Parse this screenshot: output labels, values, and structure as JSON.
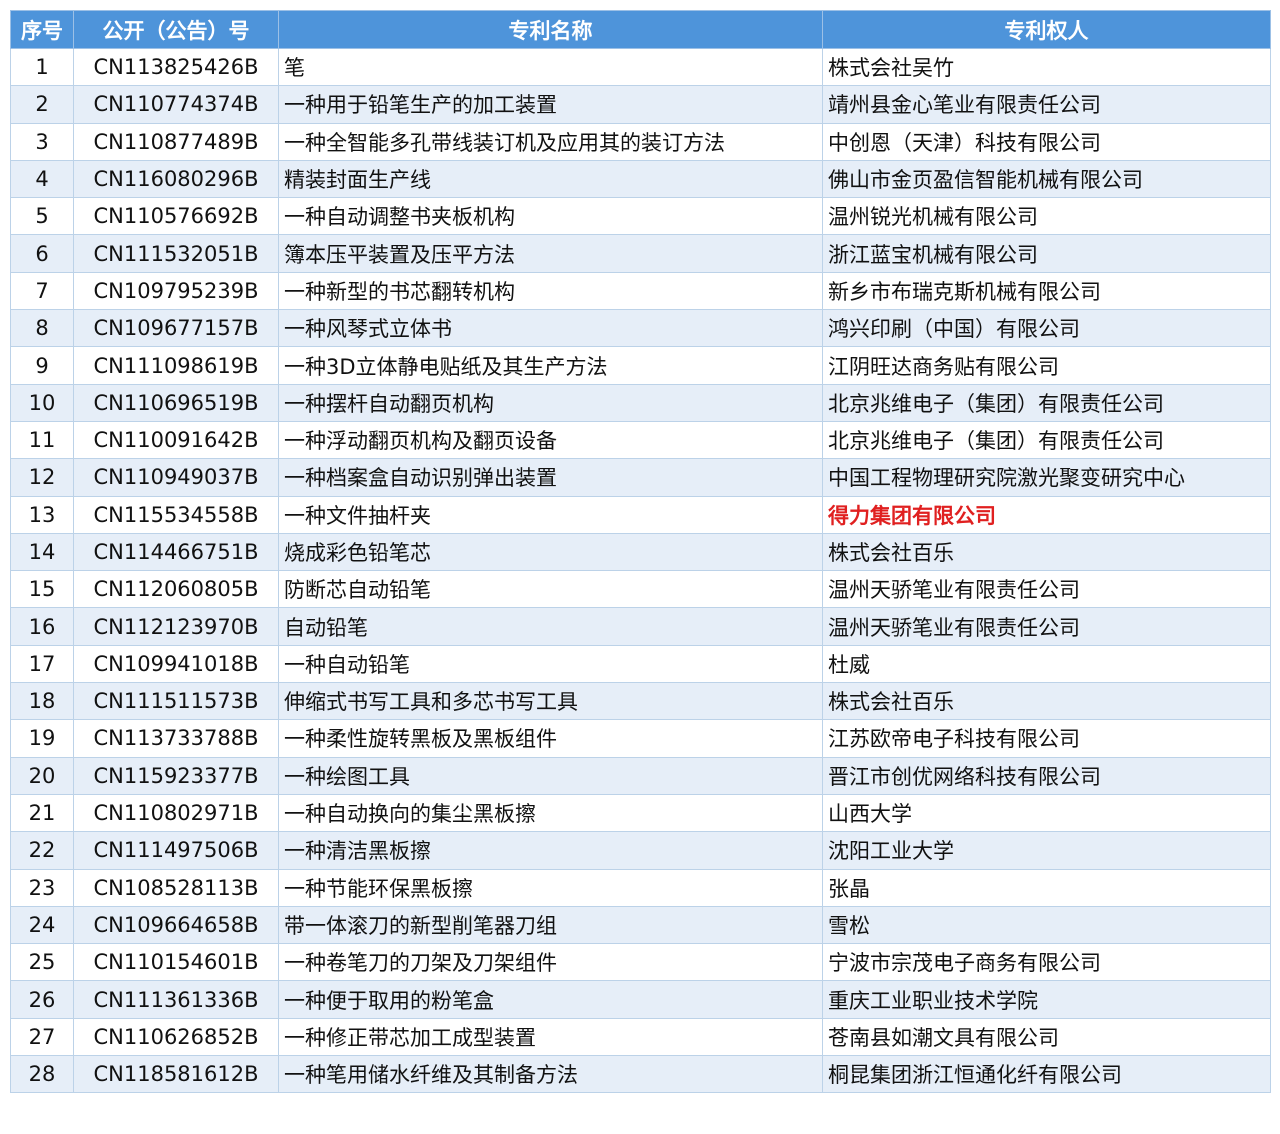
{
  "table": {
    "headers": [
      "序号",
      "公开（公告）号",
      "专利名称",
      "专利权人"
    ],
    "highlight_color": "#e02020",
    "header_color": "#4e94da",
    "rows": [
      {
        "no": "1",
        "code": "CN113825426B",
        "name": "笔",
        "owner": "株式会社吴竹"
      },
      {
        "no": "2",
        "code": "CN110774374B",
        "name": "一种用于铅笔生产的加工装置",
        "owner": "靖州县金心笔业有限责任公司"
      },
      {
        "no": "3",
        "code": "CN110877489B",
        "name": "一种全智能多孔带线装订机及应用其的装订方法",
        "owner": "中创恩（天津）科技有限公司"
      },
      {
        "no": "4",
        "code": "CN116080296B",
        "name": "精装封面生产线",
        "owner": "佛山市金页盈信智能机械有限公司"
      },
      {
        "no": "5",
        "code": "CN110576692B",
        "name": "一种自动调整书夹板机构",
        "owner": "温州锐光机械有限公司"
      },
      {
        "no": "6",
        "code": "CN111532051B",
        "name": "簿本压平装置及压平方法",
        "owner": "浙江蓝宝机械有限公司"
      },
      {
        "no": "7",
        "code": "CN109795239B",
        "name": "一种新型的书芯翻转机构",
        "owner": "新乡市布瑞克斯机械有限公司"
      },
      {
        "no": "8",
        "code": "CN109677157B",
        "name": "一种风琴式立体书",
        "owner": "鸿兴印刷（中国）有限公司"
      },
      {
        "no": "9",
        "code": "CN111098619B",
        "name": "一种3D立体静电贴纸及其生产方法",
        "owner": "江阴旺达商务贴有限公司"
      },
      {
        "no": "10",
        "code": "CN110696519B",
        "name": "一种摆杆自动翻页机构",
        "owner": "北京兆维电子（集团）有限责任公司"
      },
      {
        "no": "11",
        "code": "CN110091642B",
        "name": "一种浮动翻页机构及翻页设备",
        "owner": "北京兆维电子（集团）有限责任公司"
      },
      {
        "no": "12",
        "code": "CN110949037B",
        "name": "一种档案盒自动识别弹出装置",
        "owner": "中国工程物理研究院激光聚变研究中心"
      },
      {
        "no": "13",
        "code": "CN115534558B",
        "name": "一种文件抽杆夹",
        "owner": "得力集团有限公司",
        "highlight": true
      },
      {
        "no": "14",
        "code": "CN114466751B",
        "name": "烧成彩色铅笔芯",
        "owner": "株式会社百乐"
      },
      {
        "no": "15",
        "code": "CN112060805B",
        "name": "防断芯自动铅笔",
        "owner": "温州天骄笔业有限责任公司"
      },
      {
        "no": "16",
        "code": "CN112123970B",
        "name": "自动铅笔",
        "owner": "温州天骄笔业有限责任公司"
      },
      {
        "no": "17",
        "code": "CN109941018B",
        "name": "一种自动铅笔",
        "owner": "杜威"
      },
      {
        "no": "18",
        "code": "CN111511573B",
        "name": "伸缩式书写工具和多芯书写工具",
        "owner": "株式会社百乐"
      },
      {
        "no": "19",
        "code": "CN113733788B",
        "name": "一种柔性旋转黑板及黑板组件",
        "owner": "江苏欧帝电子科技有限公司"
      },
      {
        "no": "20",
        "code": "CN115923377B",
        "name": "一种绘图工具",
        "owner": "晋江市创优网络科技有限公司"
      },
      {
        "no": "21",
        "code": "CN110802971B",
        "name": "一种自动换向的集尘黑板擦",
        "owner": "山西大学"
      },
      {
        "no": "22",
        "code": "CN111497506B",
        "name": "一种清洁黑板擦",
        "owner": "沈阳工业大学"
      },
      {
        "no": "23",
        "code": "CN108528113B",
        "name": "一种节能环保黑板擦",
        "owner": "张晶"
      },
      {
        "no": "24",
        "code": "CN109664658B",
        "name": "带一体滚刀的新型削笔器刀组",
        "owner": "雪松"
      },
      {
        "no": "25",
        "code": "CN110154601B",
        "name": "一种卷笔刀的刀架及刀架组件",
        "owner": "宁波市宗茂电子商务有限公司"
      },
      {
        "no": "26",
        "code": "CN111361336B",
        "name": "一种便于取用的粉笔盒",
        "owner": "重庆工业职业技术学院"
      },
      {
        "no": "27",
        "code": "CN110626852B",
        "name": "一种修正带芯加工成型装置",
        "owner": "苍南县如潮文具有限公司"
      },
      {
        "no": "28",
        "code": "CN118581612B",
        "name": "一种笔用储水纤维及其制备方法",
        "owner": "桐昆集团浙江恒通化纤有限公司"
      }
    ]
  }
}
